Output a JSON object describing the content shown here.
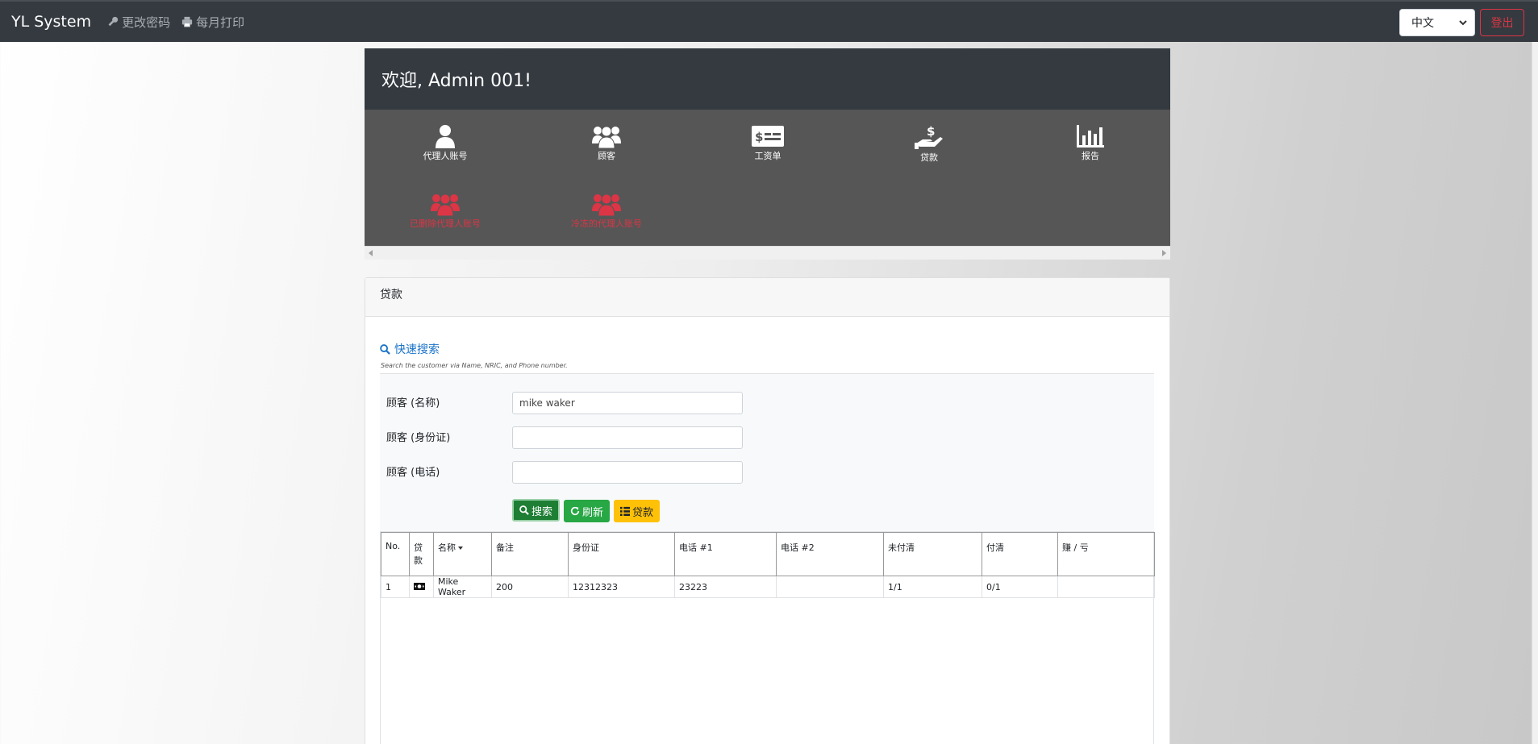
{
  "navbar": {
    "brand": "YL System",
    "change_password": "更改密码",
    "monthly_print": "每月打印",
    "language": "中文",
    "logout": "登出"
  },
  "welcome": {
    "title": "欢迎, Admin 001!"
  },
  "menu": {
    "agent_account": "代理人账号",
    "customers": "顾客",
    "payroll": "工资单",
    "loan": "贷款",
    "report": "报告",
    "deleted_agents": "已删除代理人账号",
    "frozen_agents": "冷冻的代理人账号"
  },
  "card": {
    "header": "贷款",
    "quick_search": "快速搜索",
    "hint": "Search the customer via Name, NRIC, and Phone number.",
    "fields": {
      "name_label": "顾客 (名称)",
      "name_value": "mike waker",
      "nric_label": "顾客 (身份证)",
      "nric_value": "",
      "phone_label": "顾客 (电话)",
      "phone_value": ""
    },
    "buttons": {
      "search": "搜索",
      "refresh": "刷新",
      "loan": "贷款"
    }
  },
  "table": {
    "headers": [
      "No.",
      "贷款",
      "名称",
      "备注",
      "身份证",
      "电话 #1",
      "电话 #2",
      "未付清",
      "付清",
      "赚 / 亏"
    ],
    "rows": [
      {
        "no": "1",
        "name": "Mike Waker",
        "remark": "200",
        "nric": "12312323",
        "phone1": "23223",
        "phone2": "",
        "unpaid": "1/1",
        "paid": "0/1",
        "profit": ""
      }
    ]
  }
}
